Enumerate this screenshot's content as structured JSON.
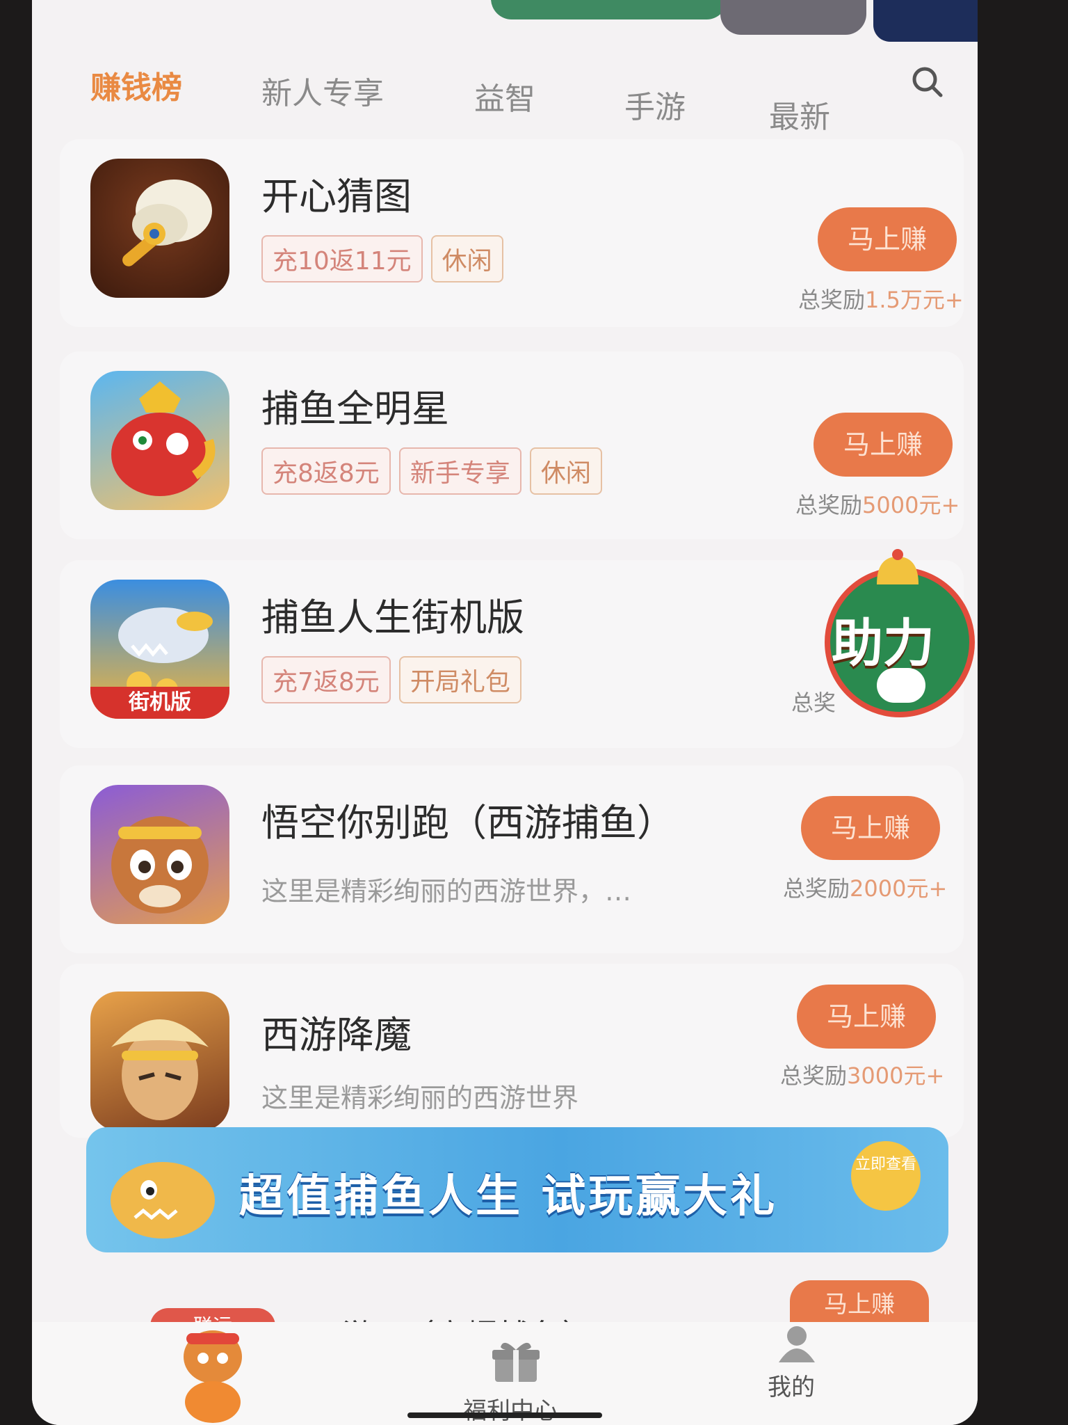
{
  "tabs": [
    "赚钱榜",
    "新人专享",
    "益智",
    "手游",
    "最新"
  ],
  "active_tab": "赚钱榜",
  "earn_label": "马上赚",
  "games": [
    {
      "title": "开心猜图",
      "tags": [
        "充10返11元",
        "休闲"
      ],
      "reward_prefix": "总奖励",
      "reward_value": "1.5万元+"
    },
    {
      "title": "捕鱼全明星",
      "tags": [
        "充8返8元",
        "新手专享",
        "休闲"
      ],
      "reward_prefix": "总奖励",
      "reward_value": "5000元+"
    },
    {
      "title": "捕鱼人生街机版",
      "tags": [
        "充7返8元",
        "开局礼包"
      ],
      "reward_prefix": "总奖",
      "icon_caption": "街机版"
    },
    {
      "title": "悟空你别跑（西游捕鱼）",
      "desc": "这里是精彩绚丽的西游世界，…",
      "reward_prefix": "总奖励",
      "reward_value": "2000元+"
    },
    {
      "title": "西游降魔",
      "desc": "这里是精彩绚丽的西游世界",
      "reward_prefix": "总奖励",
      "reward_value": "3000元+"
    }
  ],
  "boost_badge": "助力",
  "banner": {
    "text": "超值捕鱼人生 试玩赢大礼",
    "button": "立即查看"
  },
  "partial_item": {
    "title": "西游III（高爆捕鱼）",
    "badge": "联运",
    "earn": "马上赚"
  },
  "nav": {
    "center": "福利中心",
    "right": "我的"
  },
  "colors": {
    "accent": "#e8794a",
    "active_tab": "#e98a43"
  }
}
